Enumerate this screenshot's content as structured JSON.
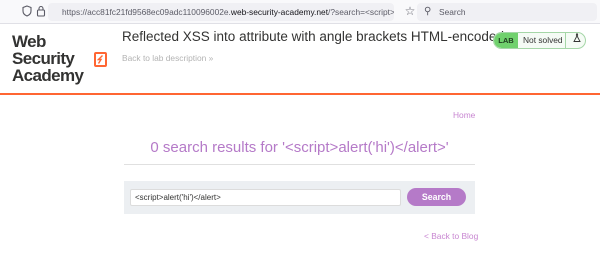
{
  "browser": {
    "url_prefix": "https://acc81fc21fd9568ec09adc110096002e.",
    "url_domain": "web-security-academy.net",
    "url_suffix": "/?search=<script>alert('hi')</al",
    "search_placeholder": "Search"
  },
  "lab": {
    "logo_line1": "Web Security",
    "logo_line2": "Academy",
    "title": "Reflected XSS into attribute with angle brackets HTML-encoded",
    "back_to_description": "Back to lab description",
    "status_tag": "LAB",
    "status_text": "Not solved"
  },
  "page": {
    "home_link": "Home",
    "results_title": "0 search results for '<script>alert('hi')</alert>'",
    "search_value": "<script>alert('hi')</alert>",
    "search_button": "Search",
    "back_to_blog": "< Back to Blog"
  },
  "colors": {
    "accent_orange": "#ff6633",
    "accent_purple": "#b57ac8",
    "status_green": "#70d16d"
  }
}
